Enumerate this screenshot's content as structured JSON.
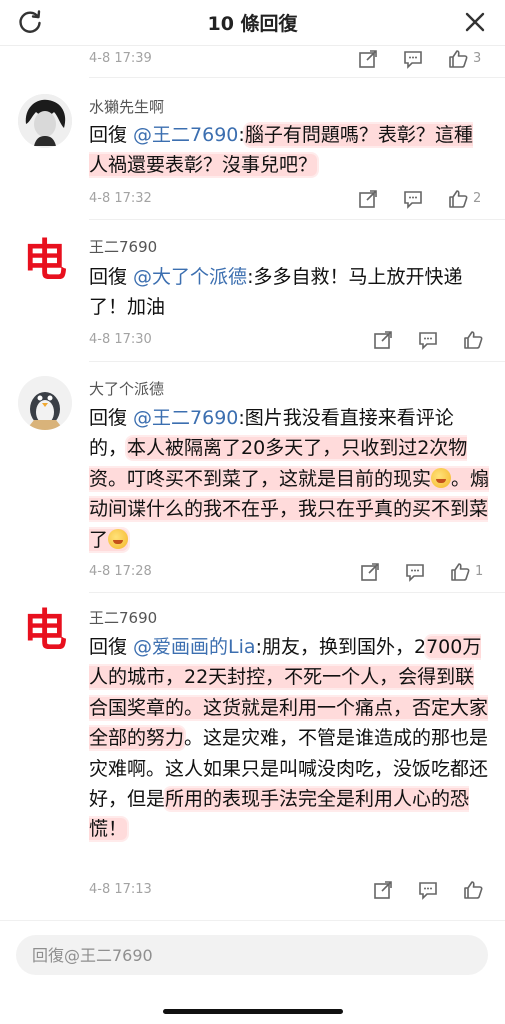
{
  "header": {
    "title": "10 條回復",
    "refresh_icon": "refresh-icon",
    "close_icon": "close-icon"
  },
  "top_partial": {
    "time": "4-8 17:39",
    "like_count": "3"
  },
  "comments": [
    {
      "username": "水獺先生啊",
      "reply_prefix": "回復 ",
      "mention": "@王二7690",
      "text_a": ":",
      "text_b": "腦子有問題嗎？表彰？這種人禍還要表彰？沒事兒吧？",
      "time": "4-8 17:32",
      "like_count": "2"
    },
    {
      "username": "王二7690",
      "avatar_text": "电",
      "reply_prefix": "回復 ",
      "mention": "@大了个派德",
      "text_a": ":多多自救！马上放开快递了！加油",
      "time": "4-8 17:30",
      "like_count": ""
    },
    {
      "username": "大了个派德",
      "reply_prefix": "回復 ",
      "mention": "@王二7690",
      "text_a": ":图片我没看直接来看评论的，",
      "text_b": "本人被隔离了20多天了，只收到过2次物资。叮咚买不到菜了，这就是目前的现实",
      "text_c": "。煽动间谍什么的我不在乎，我只在乎真的买不到菜了",
      "time": "4-8 17:28",
      "like_count": "1"
    },
    {
      "username": "王二7690",
      "avatar_text": "电",
      "reply_prefix": "回復 ",
      "mention": "@爱画画的Lia",
      "text_a": ":朋友，换到国外，2",
      "text_b": "700万人的城市，22天封控，不死一个人，会得到联合国奖章的。这货就是利用一个痛点，否定大家全部的努力",
      "text_c": "。这是灾难，不管是谁造成的那也是灾难啊。这人如果只是叫喊没肉吃，没饭吃都还好，但是",
      "text_d": "所用的表现手法完全是利用人心的恐慌！",
      "time": "4-8 17:13",
      "like_count": ""
    }
  ],
  "reply_box": {
    "placeholder": "回復@王二7690"
  }
}
